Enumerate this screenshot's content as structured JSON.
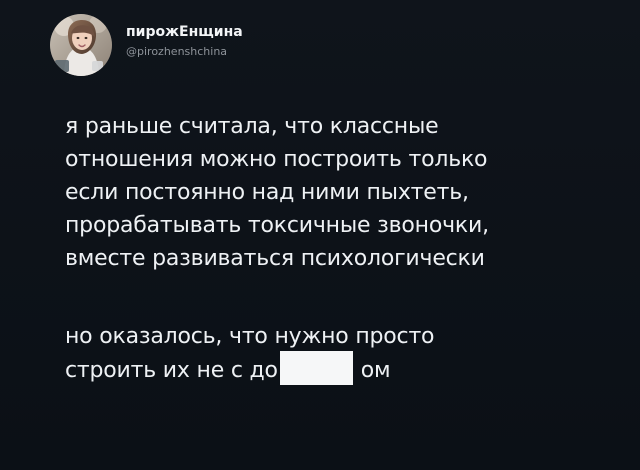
{
  "profile": {
    "display_name": "пирожЕнщина",
    "handle": "@pirozhenshchina"
  },
  "tweet": {
    "paragraph_1": [
      "я раньше считала, что классные",
      "отношения можно построить только",
      "если постоянно над ними пыхтеть,",
      "прорабатывать токсичные звоночки,",
      "вместе развиваться психологически"
    ],
    "paragraph_2": {
      "line_1": "но оказалось, что нужно просто",
      "line_2_before": "строить их не с до",
      "line_2_after": "ом"
    }
  }
}
